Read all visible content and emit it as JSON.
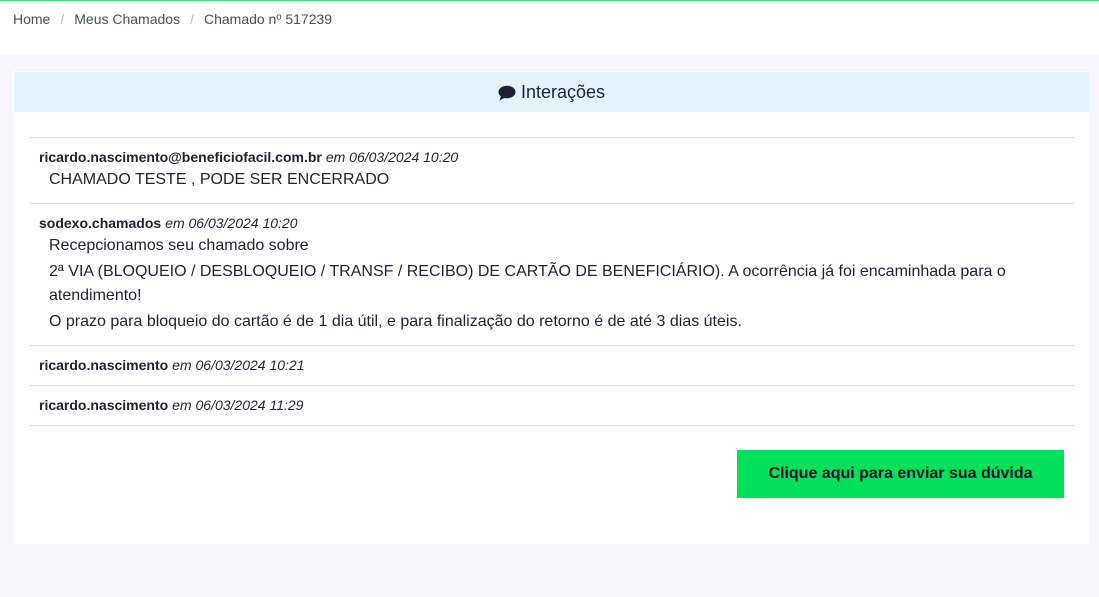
{
  "breadcrumb": {
    "home": "Home",
    "my_tickets": "Meus Chamados",
    "current": "Chamado nº 517239"
  },
  "interactions": {
    "title": "Interações",
    "items": [
      {
        "author": "ricardo.nascimento@beneficiofacil.com.br",
        "date": "em 06/03/2024 10:20",
        "lines": [
          "CHAMADO TESTE , PODE SER ENCERRADO"
        ]
      },
      {
        "author": "sodexo.chamados",
        "date": "em 06/03/2024 10:20",
        "lines": [
          "Recepcionamos seu chamado sobre",
          "2ª VIA (BLOQUEIO / DESBLOQUEIO / TRANSF / RECIBO) DE CARTÃO DE BENEFICIÁRIO). A ocorrência já foi encaminhada para o atendimento!",
          "O prazo para bloqueio do cartão é de 1 dia útil, e para finalização do retorno é de até 3 dias úteis."
        ]
      },
      {
        "author": "ricardo.nascimento",
        "date": "em 06/03/2024 10:21",
        "lines": []
      },
      {
        "author": "ricardo.nascimento",
        "date": "em 06/03/2024 11:29",
        "lines": []
      }
    ]
  },
  "actions": {
    "ask_question": "Clique aqui para enviar sua dúvida"
  },
  "colors": {
    "accent": "#00e05a",
    "header_bg": "#e2f3fb",
    "page_bg": "#f7f7fb"
  },
  "icons": {
    "header": "comment-icon"
  }
}
